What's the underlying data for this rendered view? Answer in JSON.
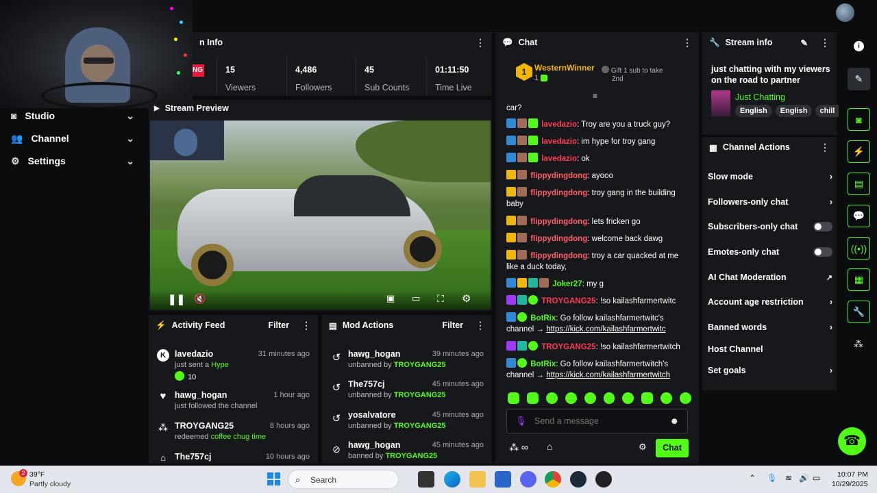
{
  "nav": {
    "items": [
      {
        "label": "Studio"
      },
      {
        "label": "Channel"
      },
      {
        "label": "Settings"
      }
    ]
  },
  "stream_info_strip": {
    "title": "n Info",
    "live_badge": "NG",
    "stats": [
      {
        "value": "15",
        "label": "Viewers"
      },
      {
        "value": "4,486",
        "label": "Followers"
      },
      {
        "value": "45",
        "label": "Sub Counts"
      },
      {
        "value": "01:11:50",
        "label": "Time Live"
      }
    ]
  },
  "preview": {
    "title": "Stream Preview"
  },
  "activity": {
    "title": "Activity Feed",
    "filter": "Filter",
    "items": [
      {
        "user": "lavedazio",
        "time": "31 minutes ago",
        "desc": "just sent a",
        "highlight": "Hype",
        "extra": "10"
      },
      {
        "user": "hawg_hogan",
        "time": "1 hour ago",
        "desc": "just followed the channel",
        "highlight": "",
        "extra": ""
      },
      {
        "user": "TROYGANG25",
        "time": "8 hours ago",
        "desc": "redeemed",
        "highlight": "coffee chug time",
        "extra": ""
      },
      {
        "user": "The757cj",
        "time": "10 hours ago",
        "desc": "",
        "highlight": "",
        "extra": ""
      }
    ]
  },
  "mod": {
    "title": "Mod Actions",
    "filter": "Filter",
    "items": [
      {
        "user": "hawg_hogan",
        "time": "39 minutes ago",
        "action": "unbanned by",
        "by": "TROYGANG25"
      },
      {
        "user": "The757cj",
        "time": "45 minutes ago",
        "action": "unbanned by",
        "by": "TROYGANG25"
      },
      {
        "user": "yosalvatore",
        "time": "45 minutes ago",
        "action": "unbanned by",
        "by": "TROYGANG25"
      },
      {
        "user": "hawg_hogan",
        "time": "45 minutes ago",
        "action": "banned by",
        "by": "TROYGANG25"
      }
    ]
  },
  "chat": {
    "title": "Chat",
    "top_gifter": {
      "rank": "1",
      "name": "WesternWinner",
      "count": "1"
    },
    "gift_prompt_line1": "Gift 1 sub to take",
    "gift_prompt_line2": "2nd",
    "fragment": "car?",
    "messages": [
      {
        "user": "lavedazio",
        "text": "Troy are you a truck guy?"
      },
      {
        "user": "lavedazio",
        "text": "im hype for troy gang"
      },
      {
        "user": "lavedazio",
        "text": "ok"
      },
      {
        "user": "flippydingdong",
        "text": "ayooo"
      },
      {
        "user": "flippydingdong",
        "text": "troy gang in the building baby"
      },
      {
        "user": "flippydingdong",
        "text": "lets fricken go"
      },
      {
        "user": "flippydingdong",
        "text": "welcome back dawg"
      },
      {
        "user": "flippydingdong",
        "text": "troy a car quacked at me like a duck today,"
      },
      {
        "user": "Joker27",
        "text": "my g"
      },
      {
        "user": "TROYGANG25",
        "text": "!so kailashfarmertwitc"
      },
      {
        "user": "BotRix",
        "text": "Go follow kailashfarmertwitc's channel → ",
        "link": "https://kick.com/kailashfarmertwitc"
      },
      {
        "user": "TROYGANG25",
        "text": "!so kailashfarmertwitch"
      },
      {
        "user": "BotRix",
        "text": "Go follow kailashfarmertwitch's channel → ",
        "link": "https://kick.com/kailashfarmertwitch"
      }
    ],
    "input_placeholder": "Send a message",
    "send_label": "Chat"
  },
  "stream_info": {
    "title": "Stream info",
    "stream_title": "just chatting with my viewers on the road to partner",
    "category": "Just Chatting",
    "tags": [
      "English",
      "English",
      "chill"
    ]
  },
  "channel_actions": {
    "title": "Channel Actions",
    "items": [
      {
        "label": "Slow mode",
        "control": "chevron"
      },
      {
        "label": "Followers-only chat",
        "control": "chevron"
      },
      {
        "label": "Subscribers-only chat",
        "control": "toggle"
      },
      {
        "label": "Emotes-only chat",
        "control": "toggle"
      },
      {
        "label": "AI Chat Moderation",
        "control": "external"
      },
      {
        "label": "Account age restriction",
        "control": "chevron"
      },
      {
        "label": "Banned words",
        "control": "chevron"
      },
      {
        "label": "Host Channel",
        "control": "none"
      },
      {
        "label": "Set goals",
        "control": "chevron"
      }
    ]
  },
  "taskbar": {
    "weather_temp": "39°F",
    "weather_desc": "Partly cloudy",
    "weather_badge": "2",
    "search": "Search",
    "time": "10:07 PM",
    "date": "10/29/2025"
  },
  "colors": {
    "accent": "#53fc18",
    "panel": "#16181c",
    "background": "#0b0c0e",
    "username_red": "#ff3d55"
  }
}
